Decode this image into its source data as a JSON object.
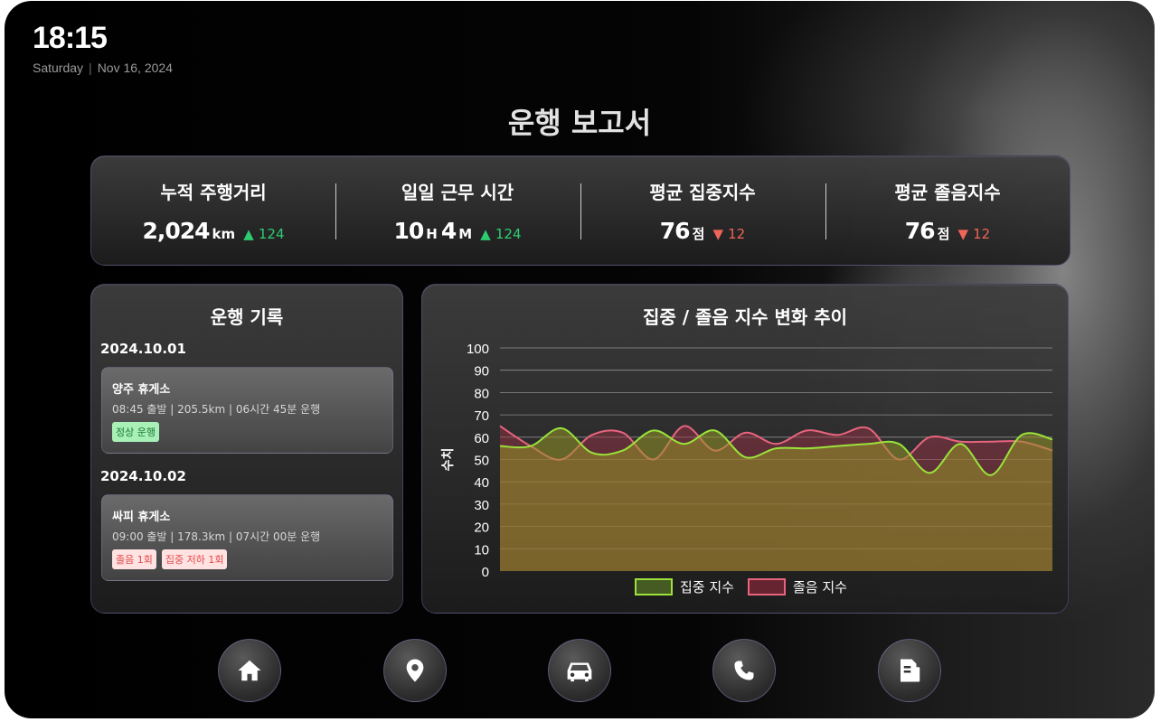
{
  "status": {
    "time": "18:15",
    "day": "Saturday",
    "date": "Nov 16, 2024"
  },
  "page_title": "운행 보고서",
  "stats": [
    {
      "label": "누적 주행거리",
      "value": "2,024",
      "unit": "km",
      "delta_dir": "▲",
      "delta": "124",
      "trend": "up"
    },
    {
      "label": "일일 근무 시간",
      "hours": "10",
      "hours_unit": "H",
      "minutes": "4",
      "minutes_unit": "M",
      "delta_dir": "▲",
      "delta": "124",
      "trend": "up"
    },
    {
      "label": "평균 집중지수",
      "value": "76",
      "unit": "점",
      "delta_dir": "▼",
      "delta": "12",
      "trend": "down"
    },
    {
      "label": "평균 졸음지수",
      "value": "76",
      "unit": "점",
      "delta_dir": "▼",
      "delta": "12",
      "trend": "down"
    }
  ],
  "log": {
    "title": "운행 기록",
    "days": [
      {
        "date": "2024.10.01",
        "place": "양주 휴게소",
        "meta": "08:45 출발  |  205.5km  |  06시간 45분 운행",
        "tags": [
          "정상 운행"
        ]
      },
      {
        "date": "2024.10.02",
        "place": "싸피 휴게소",
        "meta": "09:00 출발  |  178.3km  |  07시간 00분 운행",
        "tags": [
          "졸음 1회",
          "집중 저하 1회"
        ]
      }
    ]
  },
  "chart_data": {
    "type": "area",
    "title": "집중 / 졸음 지수 변화 추이",
    "xlabel": "",
    "ylabel": "수치",
    "ylim": [
      0,
      100
    ],
    "yticks": [
      0,
      10,
      20,
      30,
      40,
      50,
      60,
      70,
      80,
      90,
      100
    ],
    "grid": true,
    "legend_position": "bottom",
    "series": [
      {
        "name": "집중 지수",
        "color": "#9be33a",
        "values": [
          56,
          56,
          64,
          53,
          54,
          63,
          57,
          63,
          51,
          55,
          55,
          56,
          57,
          57,
          44,
          57,
          43,
          61,
          59
        ]
      },
      {
        "name": "졸음 지수",
        "color": "#e8647e",
        "values": [
          65,
          56,
          50,
          61,
          62,
          50,
          65,
          54,
          62,
          57,
          63,
          61,
          64,
          50,
          60,
          58,
          58,
          58,
          54
        ]
      }
    ]
  },
  "nav": [
    {
      "name": "home",
      "icon": "home-icon"
    },
    {
      "name": "location",
      "icon": "map-pin-icon"
    },
    {
      "name": "car",
      "icon": "car-icon"
    },
    {
      "name": "phone",
      "icon": "phone-icon"
    },
    {
      "name": "report",
      "icon": "document-icon"
    }
  ]
}
